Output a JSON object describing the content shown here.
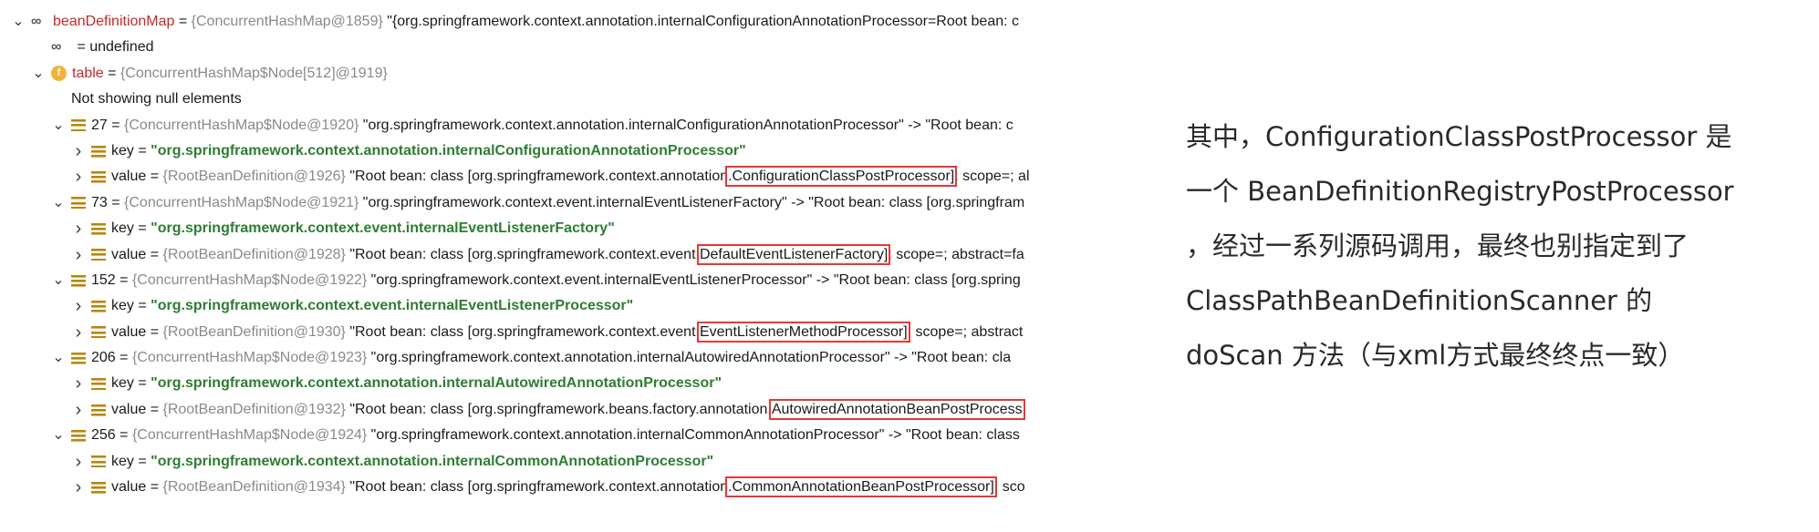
{
  "tree": {
    "rows": [
      {
        "indent": 0,
        "chev": "v",
        "icon": "infinity",
        "name": "beanDefinitionMap",
        "sep": " = ",
        "type": "{ConcurrentHashMap@1859}",
        "value": " \"{org.springframework.context.annotation.internalConfigurationAnnotationProcessor=Root bean: c"
      },
      {
        "indent": 1,
        "chev": "",
        "icon": "infinity",
        "name": "",
        "sep": " = ",
        "type": "",
        "value": "undefined"
      },
      {
        "indent": 1,
        "chev": "v",
        "icon": "field",
        "name": "table",
        "sep": " = ",
        "type": "{ConcurrentHashMap$Node[512]@1919}",
        "value": ""
      },
      {
        "indent": 2,
        "chev": "",
        "icon": "",
        "name": "",
        "sep": "",
        "type": "",
        "value": "Not showing null elements"
      },
      {
        "indent": 2,
        "chev": "v",
        "icon": "list",
        "name": "27",
        "sep": " = ",
        "type": "{ConcurrentHashMap$Node@1920}",
        "value": " \"org.springframework.context.annotation.internalConfigurationAnnotationProcessor\" -> \"Root bean: c"
      },
      {
        "indent": 3,
        "chev": ">",
        "icon": "list",
        "name": "key",
        "sep": " = ",
        "type": "",
        "value": "\"org.springframework.context.annotation.internalConfigurationAnnotationProcessor\"",
        "green": true
      },
      {
        "indent": 3,
        "chev": ">",
        "icon": "list",
        "name": "value",
        "sep": " = ",
        "type": "{RootBeanDefinition@1926}",
        "value": " \"Root bean: class [org.springframework.context.annotation",
        "boxed": ".ConfigurationClassPostProcessor]",
        "rest": "; scope=; al"
      },
      {
        "indent": 2,
        "chev": "v",
        "icon": "list",
        "name": "73",
        "sep": " = ",
        "type": "{ConcurrentHashMap$Node@1921}",
        "value": " \"org.springframework.context.event.internalEventListenerFactory\" -> \"Root bean: class [org.springfram"
      },
      {
        "indent": 3,
        "chev": ">",
        "icon": "list",
        "name": "key",
        "sep": " = ",
        "type": "",
        "value": "\"org.springframework.context.event.internalEventListenerFactory\"",
        "green": true
      },
      {
        "indent": 3,
        "chev": ">",
        "icon": "list",
        "name": "value",
        "sep": " = ",
        "type": "{RootBeanDefinition@1928}",
        "value": " \"Root bean: class [org.springframework.context.event.",
        "boxed": "DefaultEventListenerFactory]",
        "rest": "; scope=; abstract=fa"
      },
      {
        "indent": 2,
        "chev": "v",
        "icon": "list",
        "name": "152",
        "sep": " = ",
        "type": "{ConcurrentHashMap$Node@1922}",
        "value": " \"org.springframework.context.event.internalEventListenerProcessor\" -> \"Root bean: class [org.spring"
      },
      {
        "indent": 3,
        "chev": ">",
        "icon": "list",
        "name": "key",
        "sep": " = ",
        "type": "",
        "value": "\"org.springframework.context.event.internalEventListenerProcessor\"",
        "green": true
      },
      {
        "indent": 3,
        "chev": ">",
        "icon": "list",
        "name": "value",
        "sep": " = ",
        "type": "{RootBeanDefinition@1930}",
        "value": " \"Root bean: class [org.springframework.context.event.",
        "boxed": "EventListenerMethodProcessor]",
        "rest": "; scope=; abstract"
      },
      {
        "indent": 2,
        "chev": "v",
        "icon": "list",
        "name": "206",
        "sep": " = ",
        "type": "{ConcurrentHashMap$Node@1923}",
        "value": " \"org.springframework.context.annotation.internalAutowiredAnnotationProcessor\" -> \"Root bean: cla"
      },
      {
        "indent": 3,
        "chev": ">",
        "icon": "list",
        "name": "key",
        "sep": " = ",
        "type": "",
        "value": "\"org.springframework.context.annotation.internalAutowiredAnnotationProcessor\"",
        "green": true
      },
      {
        "indent": 3,
        "chev": ">",
        "icon": "list",
        "name": "value",
        "sep": " = ",
        "type": "{RootBeanDefinition@1932}",
        "value": " \"Root bean: class [org.springframework.beans.factory.annotation.",
        "boxed": "AutowiredAnnotationBeanPostProcess",
        "rest": ""
      },
      {
        "indent": 2,
        "chev": "v",
        "icon": "list",
        "name": "256",
        "sep": " = ",
        "type": "{ConcurrentHashMap$Node@1924}",
        "value": " \"org.springframework.context.annotation.internalCommonAnnotationProcessor\" -> \"Root bean: class"
      },
      {
        "indent": 3,
        "chev": ">",
        "icon": "list",
        "name": "key",
        "sep": " = ",
        "type": "",
        "value": "\"org.springframework.context.annotation.internalCommonAnnotationProcessor\"",
        "green": true
      },
      {
        "indent": 3,
        "chev": ">",
        "icon": "list",
        "name": "value",
        "sep": " = ",
        "type": "{RootBeanDefinition@1934}",
        "value": " \"Root bean: class [org.springframework.context.annotation",
        "boxed": ".CommonAnnotationBeanPostProcessor]",
        "rest": "; sco"
      }
    ]
  },
  "description": {
    "lines": [
      "其中，ConfigurationClassPostProcessor 是",
      "一个 BeanDefinitionRegistryPostProcessor",
      "，经过一系列源码调用，最终也别指定到了",
      "ClassPathBeanDefinitionScanner 的",
      "doScan 方法（与xml方式最终终点一致）"
    ]
  }
}
